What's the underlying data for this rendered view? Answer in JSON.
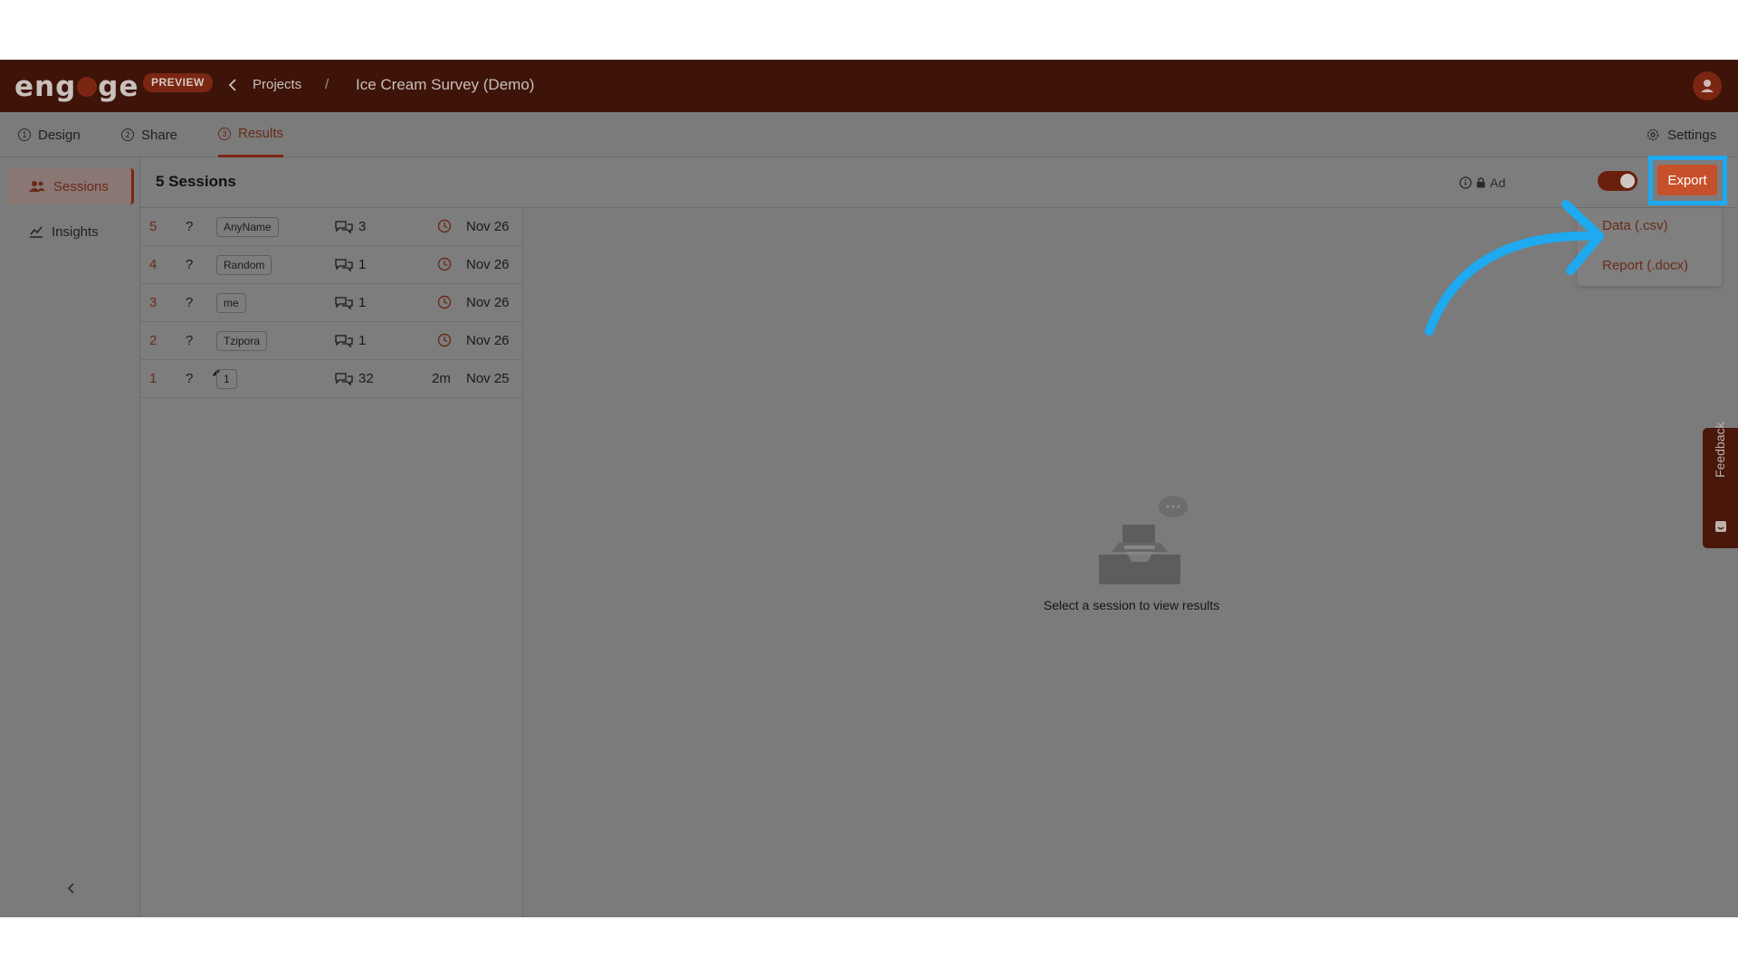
{
  "header": {
    "logo": "engage",
    "badge": "PREVIEW",
    "breadcrumb_projects": "Projects",
    "breadcrumb_separator": "/",
    "project_title": "Ice Cream Survey (Demo)"
  },
  "tabs": [
    {
      "num": "1",
      "label": "Design"
    },
    {
      "num": "2",
      "label": "Share"
    },
    {
      "num": "3",
      "label": "Results"
    }
  ],
  "settings_label": "Settings",
  "sidebar": {
    "items": [
      {
        "label": "Sessions"
      },
      {
        "label": "Insights"
      }
    ]
  },
  "sessions": {
    "count_label": "5 Sessions",
    "advanced_label": "Ad",
    "rows": [
      {
        "idx": "5",
        "status": "?",
        "name": "AnyName",
        "messages": "3",
        "date": "Nov 26"
      },
      {
        "idx": "4",
        "status": "?",
        "name": "Random",
        "messages": "1",
        "date": "Nov 26"
      },
      {
        "idx": "3",
        "status": "?",
        "name": "me",
        "messages": "1",
        "date": "Nov 26"
      },
      {
        "idx": "2",
        "status": "?",
        "name": "Tzipora",
        "messages": "1",
        "date": "Nov 26"
      },
      {
        "idx": "1",
        "status": "?",
        "name": "1",
        "messages": "32",
        "duration": "2m",
        "date": "Nov 25"
      }
    ]
  },
  "export": {
    "button_label": "Export",
    "options": [
      "Data (.csv)",
      "Report (.docx)"
    ]
  },
  "empty_state": "Select a session to view results",
  "feedback_label": "Feedback",
  "colors": {
    "accent": "#c6502a",
    "highlight": "#1ea9f0",
    "topbar": "#3e1409"
  }
}
